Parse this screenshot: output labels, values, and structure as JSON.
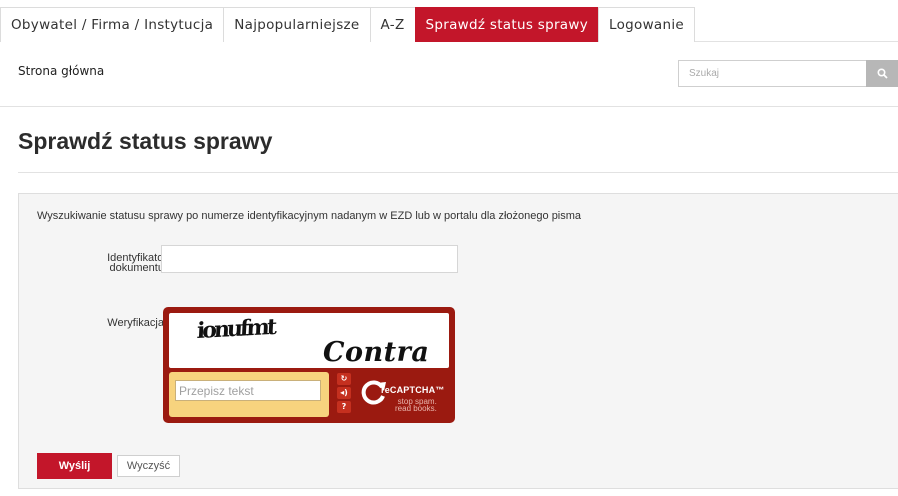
{
  "nav": {
    "tabs": [
      {
        "label": "Obywatel / Firma / Instytucja",
        "active": false
      },
      {
        "label": "Najpopularniejsze",
        "active": false
      },
      {
        "label": "A-Z",
        "active": false
      },
      {
        "label": "Sprawdź status sprawy",
        "active": true
      },
      {
        "label": "Logowanie",
        "active": false
      }
    ]
  },
  "breadcrumb": "Strona główna",
  "search": {
    "placeholder": "Szukaj",
    "icon": "search-icon"
  },
  "page": {
    "title": "Sprawdź status sprawy"
  },
  "form": {
    "intro": "Wyszukiwanie statusu sprawy po numerze identyfikacyjnym nadanym w EZD lub w portalu dla złożonego pisma",
    "id_label_line1": "Identyfikator",
    "id_label_line2": "dokumentu:",
    "id_value": "",
    "verification_label": "Weryfikacja:",
    "submit_label": "Wyślij",
    "clear_label": "Wyczyść"
  },
  "captcha": {
    "word1": "ionufmt",
    "word2": "Contra",
    "input_placeholder": "Przepisz tekst",
    "brand": "reCAPTCHA™",
    "tagline": "stop spam.\nread books.",
    "colors": {
      "frame": "#9b1a10",
      "input_area": "#f7d37e"
    }
  },
  "colors": {
    "accent": "#c3162a"
  }
}
